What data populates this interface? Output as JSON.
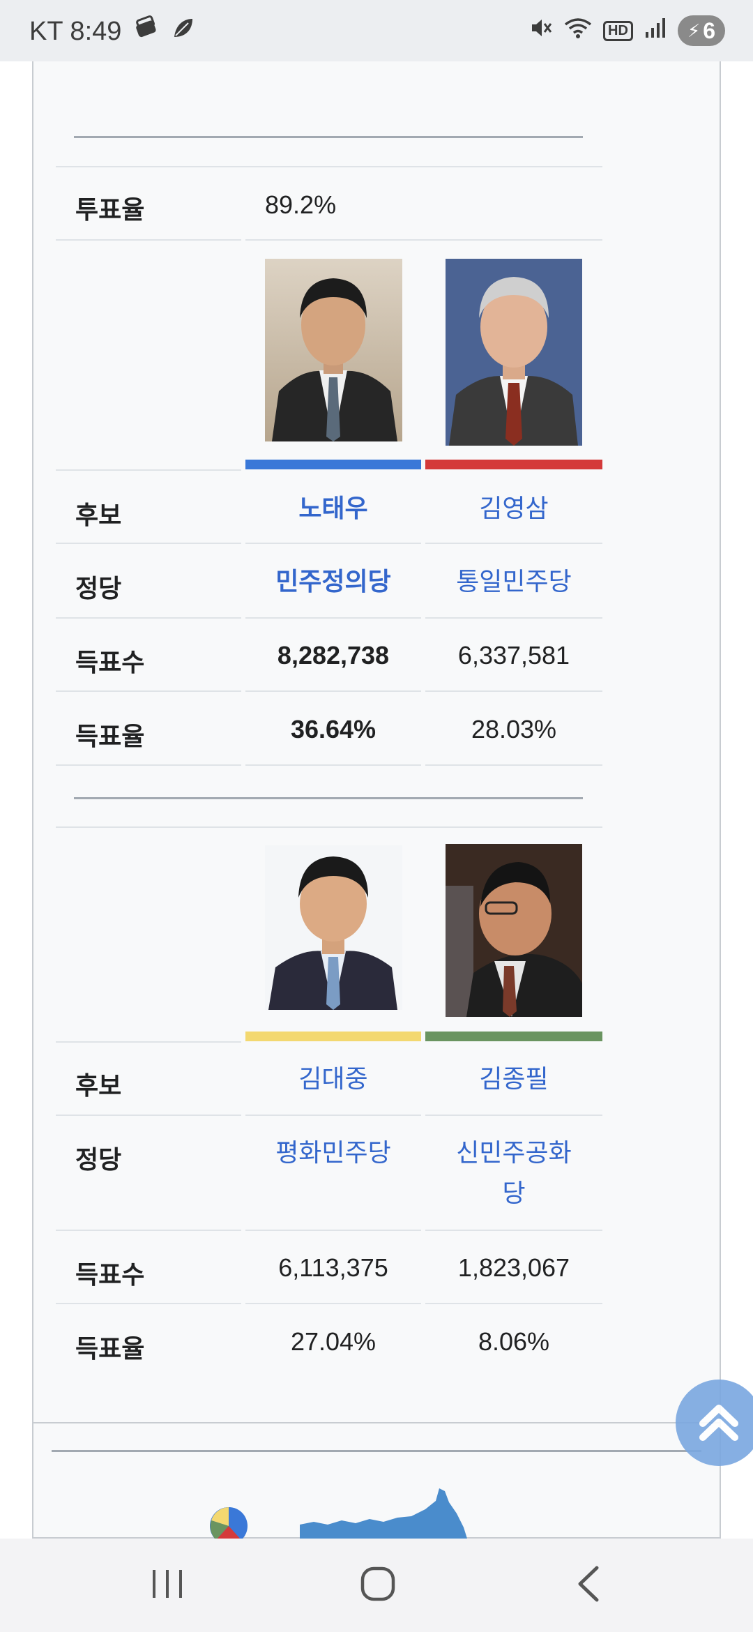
{
  "status_bar": {
    "carrier_time": "KT 8:49",
    "battery": "6",
    "hd_label": "HD"
  },
  "group1": {
    "turnout_label": "투표율",
    "turnout_value": "89.2%",
    "candidate_label": "후보",
    "party_label": "정당",
    "votes_label": "득표수",
    "share_label": "득표율",
    "candidates": [
      {
        "name": "노태우",
        "party": "민주정의당",
        "votes": "8,282,738",
        "share": "36.64%",
        "color": "#3a78d8",
        "photo": "roh-tae-woo-photo"
      },
      {
        "name": "김영삼",
        "party": "통일민주당",
        "votes": "6,337,581",
        "share": "28.03%",
        "color": "#d43a3a",
        "photo": "kim-young-sam-photo"
      }
    ]
  },
  "group2": {
    "candidate_label": "후보",
    "party_label": "정당",
    "votes_label": "득표수",
    "share_label": "득표율",
    "candidates": [
      {
        "name": "김대중",
        "party": "평화민주당",
        "votes": "6,113,375",
        "share": "27.04%",
        "color": "#f3d870",
        "photo": "kim-dae-jung-photo"
      },
      {
        "name": "김종필",
        "party_line1": "신민주공화",
        "party_line2": "당",
        "votes": "1,823,067",
        "share": "8.06%",
        "color": "#6a9460",
        "photo": "kim-jong-pil-photo"
      }
    ]
  },
  "nav": {
    "recent_icon": "recent-apps-icon",
    "home_icon": "home-icon",
    "back_icon": "back-icon"
  }
}
